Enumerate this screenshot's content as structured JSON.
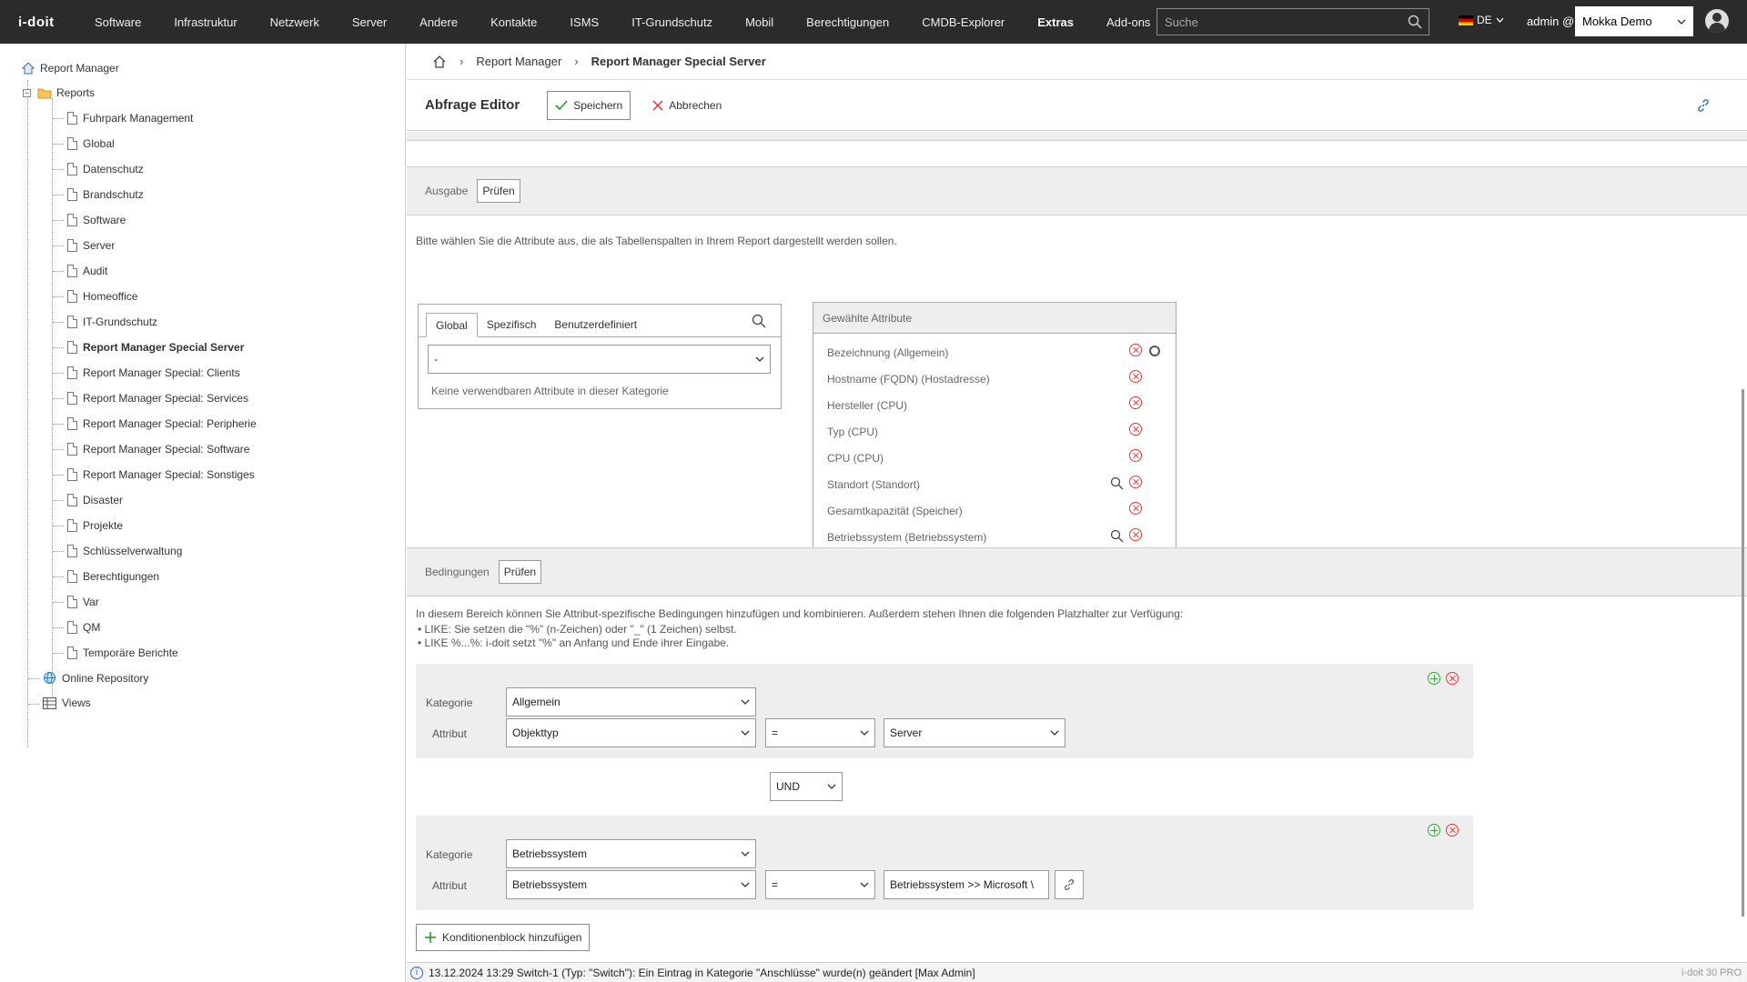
{
  "app": {
    "logo": "i-doit"
  },
  "nav": {
    "items": [
      "Software",
      "Infrastruktur",
      "Netzwerk",
      "Server",
      "Andere",
      "Kontakte",
      "ISMS",
      "IT-Grundschutz",
      "Mobil",
      "Berechtigungen",
      "CMDB-Explorer",
      "Extras",
      "Add-ons"
    ],
    "active": "Extras",
    "search_placeholder": "Suche",
    "lang": "DE",
    "user": "admin @",
    "tenant": "Mokka Demo"
  },
  "sidebar": {
    "root": "Report Manager",
    "reports_label": "Reports",
    "reports": [
      "Fuhrpark Management",
      "Global",
      "Datenschutz",
      "Brandschutz",
      "Software",
      "Server",
      "Audit",
      "Homeoffice",
      "IT-Grundschutz",
      "Report Manager Special Server",
      "Report Manager Special: Clients",
      "Report Manager Special: Services",
      "Report Manager Special: Peripherie",
      "Report Manager Special: Software",
      "Report Manager Special: Sonstiges",
      "Disaster",
      "Projekte",
      "Schlüsselverwaltung",
      "Berechtigungen",
      "Var",
      "QM",
      "Temporäre Berichte"
    ],
    "selected": "Report Manager Special Server",
    "online_repo": "Online Repository",
    "views": "Views"
  },
  "breadcrumb": {
    "parent": "Report Manager",
    "current": "Report Manager Special Server"
  },
  "toolbar": {
    "title": "Abfrage Editor",
    "save": "Speichern",
    "cancel": "Abbrechen"
  },
  "output": {
    "section_label": "Ausgabe",
    "check_button": "Prüfen",
    "hint": "Bitte wählen Sie die Attribute aus, die als Tabellenspalten in Ihrem Report dargestellt werden sollen.",
    "tabs": [
      "Global",
      "Spezifisch",
      "Benutzerdefiniert"
    ],
    "active_tab": "Global",
    "category_select": "-",
    "empty_text": "Keine verwendbaren Attribute in dieser Kategorie",
    "selected_header": "Gewählte Attribute",
    "selected": [
      {
        "label": "Bezeichnung (Allgemein)",
        "search": false
      },
      {
        "label": "Hostname (FQDN) (Hostadresse)",
        "search": false
      },
      {
        "label": "Hersteller (CPU)",
        "search": false
      },
      {
        "label": "Typ (CPU)",
        "search": false
      },
      {
        "label": "CPU (CPU)",
        "search": false
      },
      {
        "label": "Standort (Standort)",
        "search": true
      },
      {
        "label": "Gesamtkapazität (Speicher)",
        "search": false
      },
      {
        "label": "Betriebssystem (Betriebssystem)",
        "search": true
      }
    ]
  },
  "conditions": {
    "section_label": "Bedingungen",
    "check_button": "Prüfen",
    "intro": "In diesem Bereich können Sie Attribut-spezifische Bedingungen hinzufügen und kombinieren. Außerdem stehen Ihnen die folgenden Platzhalter zur Verfügung:",
    "bullets": [
      "LIKE: Sie setzen die \"%\" (n-Zeichen) oder \"_\" (1 Zeichen) selbst.",
      "LIKE %...%: i-doit setzt \"%\" an Anfang und Ende ihrer Eingabe."
    ],
    "kategorie_label": "Kategorie",
    "attribut_label": "Attribut",
    "block1": {
      "kategorie": "Allgemein",
      "attribut": "Objekttyp",
      "operator": "=",
      "value": "Server"
    },
    "connector": "UND",
    "block2": {
      "kategorie": "Betriebssystem",
      "attribut": "Betriebssystem",
      "operator": "=",
      "value": "Betriebssystem >> Microsoft \\"
    },
    "add_block": "Konditionenblock hinzufügen"
  },
  "footer": {
    "message": "13.12.2024 13:29 Switch-1 (Typ: \"Switch\"): Ein Eintrag in Kategorie \"Anschlüsse\" wurde(n) geändert [Max Admin]",
    "version": "i-doit 30 PRO"
  }
}
